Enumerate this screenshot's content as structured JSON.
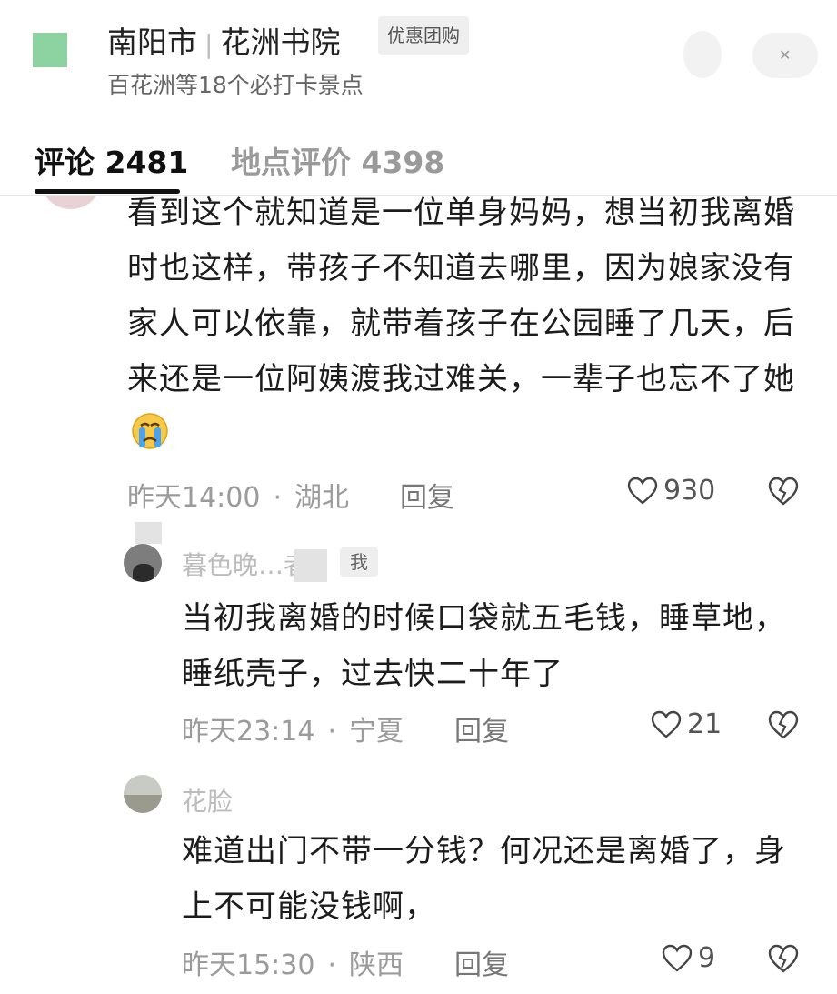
{
  "header": {
    "city": "南阳市",
    "place": "花洲书院",
    "badge": "优惠团购",
    "subtitle": "百花洲等18个必打卡景点"
  },
  "tabs": [
    {
      "label": "评论",
      "count": "2481",
      "active": true
    },
    {
      "label": "地点评价",
      "count": "4398",
      "active": false
    }
  ],
  "comment": {
    "text": "看到这个就知道是一位单身妈妈，想当初我离婚时也这样，带孩子不知道去哪里，因为娘家没有家人可以依靠，就带着孩子在公园睡了几天，后来还是一位阿姨渡我过难关，一辈子也忘不了她",
    "emoji": "crying-face",
    "time": "昨天14:00",
    "location": "湖北",
    "reply_label": "回复",
    "likes": "930"
  },
  "replies": [
    {
      "name": "暮色晚…者",
      "badge": "我",
      "text": "当初我离婚的时候口袋就五毛钱，睡草地，睡纸壳子，过去快二十年了",
      "time": "昨天23:14",
      "location": "宁夏",
      "reply_label": "回复",
      "likes": "21"
    },
    {
      "name": "花脸",
      "text": "难道出门不带一分钱？何况还是离婚了，身上不可能没钱啊，",
      "time": "昨天15:30",
      "location": "陕西",
      "reply_label": "回复",
      "likes": "9"
    }
  ],
  "meta_separator": "·",
  "colors": {
    "accent": "#111111",
    "muted": "#9b9b9b",
    "thumb": "#8dd3a1"
  }
}
